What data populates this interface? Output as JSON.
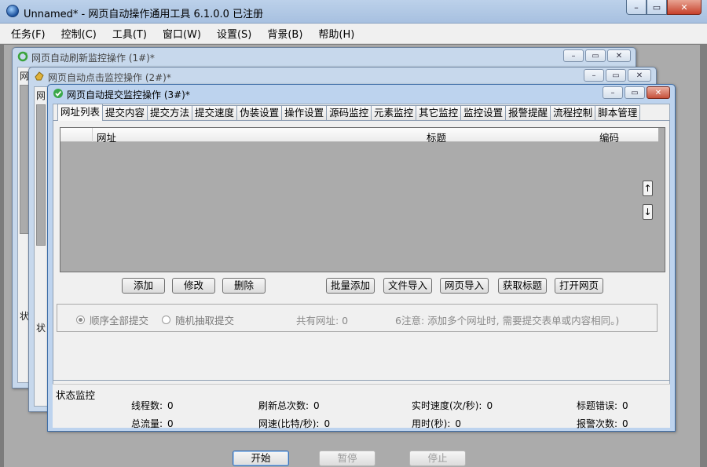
{
  "app": {
    "title": "Unnamed* - 网页自动操作通用工具 6.1.0.0  已注册"
  },
  "menu": [
    "任务(F)",
    "控制(C)",
    "工具(T)",
    "窗口(W)",
    "设置(S)",
    "背景(B)",
    "帮助(H)"
  ],
  "windows": {
    "w1_title": "网页自动刷新监控操作  (1#)*",
    "w2_title": "网页自动点击监控操作  (2#)*",
    "w3_title": "网页自动提交监控操作  (3#)*",
    "w1_ghost": "网",
    "w1_status_ghost": "状",
    "w2_ghost": "网",
    "w2_status_ghost": "状"
  },
  "tabs": [
    "网址列表",
    "提交内容",
    "提交方法",
    "提交速度",
    "伪装设置",
    "操作设置",
    "源码监控",
    "元素监控",
    "其它监控",
    "监控设置",
    "报警提醒",
    "流程控制",
    "脚本管理"
  ],
  "grid": {
    "columns": [
      "网址",
      "标题",
      "编码"
    ],
    "up_arrow": "↑",
    "down_arrow": "↓"
  },
  "buttons": {
    "add": "添加",
    "edit": "修改",
    "delete": "删除",
    "batch_add": "批量添加",
    "file_import": "文件导入",
    "web_import": "网页导入",
    "get_title": "获取标题",
    "open_page": "打开网页"
  },
  "options": {
    "seq_label": "顺序全部提交",
    "random_label": "随机抽取提交",
    "total_label": "共有网址:  0",
    "note": "6注意: 添加多个网址时, 需要提交表单或内容相同。)"
  },
  "status": {
    "title": "状态监控",
    "threads_label": "线程数:",
    "threads_value": "0",
    "refresh_label": "刷新总次数:",
    "refresh_value": "0",
    "speed_label": "实时速度(次/秒):",
    "speed_value": "0",
    "title_err_label": "标题错误:",
    "title_err_value": "0",
    "traffic_label": "总流量:",
    "traffic_value": "0",
    "netspeed_label": "网速(比特/秒):",
    "netspeed_value": "0",
    "time_label": "用时(秒):",
    "time_value": "0",
    "alarm_label": "报警次数:",
    "alarm_value": "0"
  },
  "controls": {
    "start": "开始",
    "pause": "暂停",
    "stop": "停止"
  },
  "caption": {
    "minimize": "–",
    "restore": "▭",
    "close": "✕"
  }
}
